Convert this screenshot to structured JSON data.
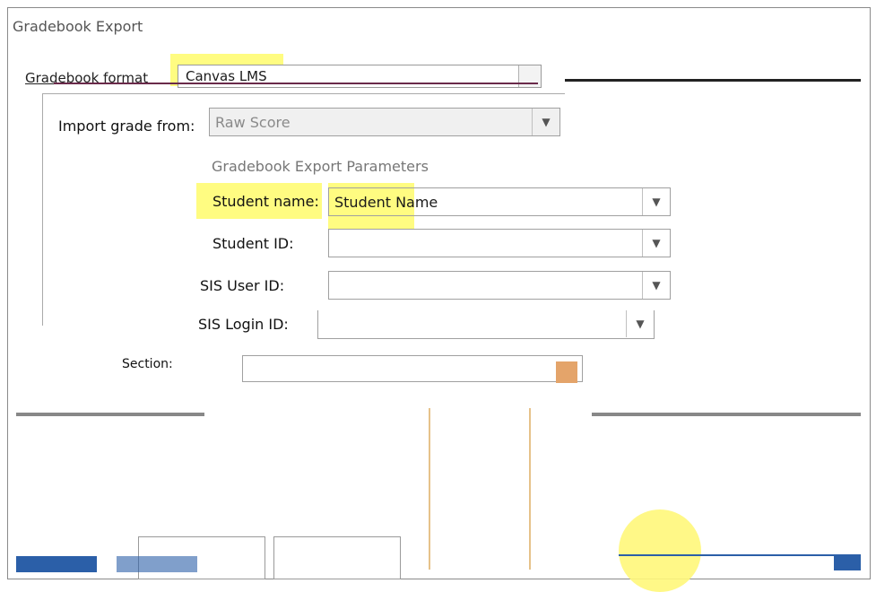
{
  "window": {
    "title": "Gradebook Export"
  },
  "top_row": {
    "label": "Gradebook format",
    "select_value": "Canvas LMS"
  },
  "import": {
    "label": "Import grade from:",
    "select_value": "Raw Score"
  },
  "parameters": {
    "section_title": "Gradebook Export Parameters",
    "student_name": {
      "label": "Student name:",
      "value": "Student Name"
    },
    "student_id": {
      "label": "Student ID:",
      "value": ""
    },
    "sis_user_id": {
      "label": "SIS User ID:",
      "value": ""
    },
    "sis_login_id": {
      "label": "SIS Login ID:",
      "value": ""
    },
    "section": {
      "label": "Section:",
      "value": ""
    }
  },
  "colors": {
    "highlight": "#fffb6b",
    "accent": "#2b5fa8"
  }
}
